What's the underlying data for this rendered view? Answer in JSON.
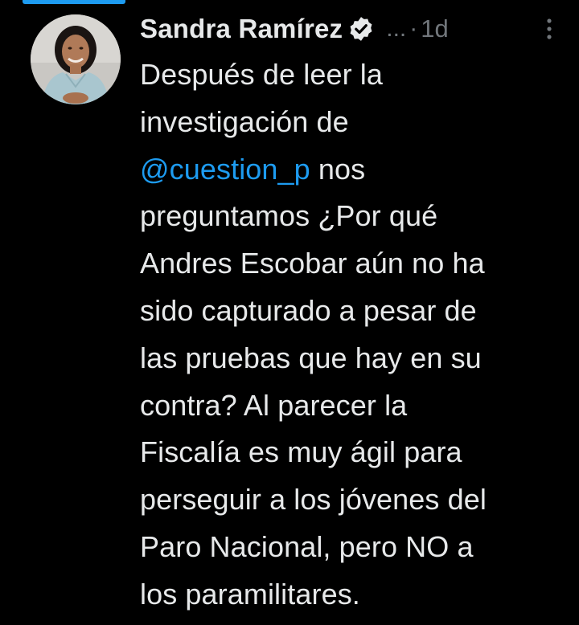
{
  "colors": {
    "background": "#000000",
    "text": "#e7e9ea",
    "muted": "#71767b",
    "link": "#1d9bf0"
  },
  "tweet": {
    "author": {
      "display_name": "Sandra Ramírez",
      "verified_icon": "verified-badge-icon",
      "handle_truncated": "...",
      "avatar": "profile-photo"
    },
    "separator": "·",
    "time_ago": "1d",
    "more_icon": "more-vertical-icon",
    "text_lines": [
      {
        "before": "Después de leer la"
      },
      {
        "before": "investigación de"
      },
      {
        "mention": "@cuestion_p",
        "after": " nos"
      },
      {
        "before": "preguntamos ¿Por qué"
      },
      {
        "before": "Andres Escobar aún no ha"
      },
      {
        "before": "sido capturado a pesar de"
      },
      {
        "before": "las pruebas que hay en su"
      },
      {
        "before": "contra? Al parecer la"
      },
      {
        "before": "Fiscalía es muy ágil para"
      },
      {
        "before": "perseguir a los jóvenes del"
      },
      {
        "before": "Paro Nacional, pero NO a"
      },
      {
        "before": "los paramilitares."
      }
    ]
  }
}
